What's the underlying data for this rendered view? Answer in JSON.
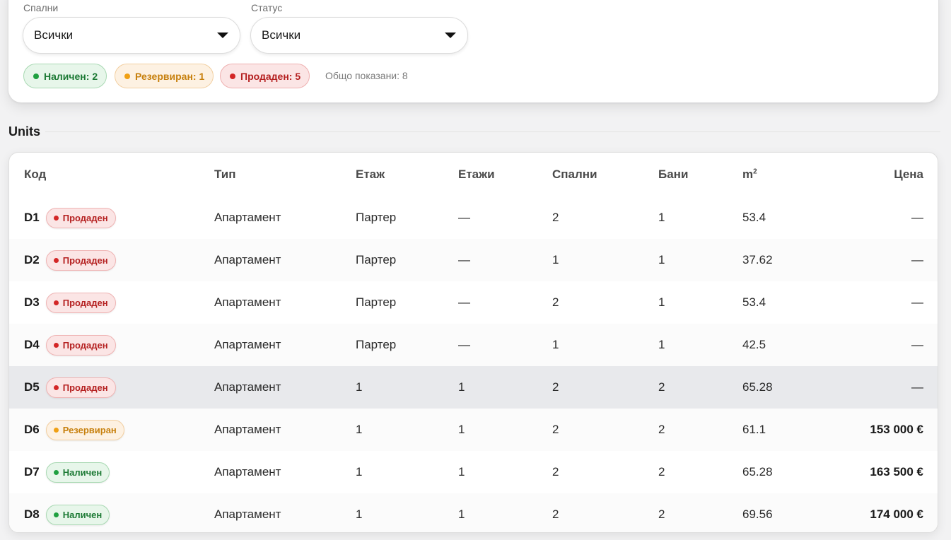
{
  "filters": {
    "bedrooms": {
      "label": "Спални",
      "value": "Всички"
    },
    "status": {
      "label": "Статус",
      "value": "Всички"
    },
    "pills": [
      {
        "label": "Наличен: 2",
        "color": "#1fa040"
      },
      {
        "label": "Резервиран: 1",
        "color": "#f0a014"
      },
      {
        "label": "Продаден: 5",
        "color": "#d32626"
      }
    ],
    "total_shown": "Общо показани: 8"
  },
  "units": {
    "title": "Units",
    "columns": {
      "code": "Код",
      "type": "Тип",
      "floor": "Етаж",
      "floors": "Етажи",
      "bedrooms": "Спални",
      "bathrooms": "Бани",
      "area": "m",
      "area_sup": "2",
      "price": "Цена"
    },
    "rows": [
      {
        "code": "D1",
        "status": "Продаден",
        "type": "Апартамент",
        "floor": "Партер",
        "floors": "—",
        "bedrooms": "2",
        "bathrooms": "1",
        "area": "53.4",
        "price": "—"
      },
      {
        "code": "D2",
        "status": "Продаден",
        "type": "Апартамент",
        "floor": "Партер",
        "floors": "—",
        "bedrooms": "1",
        "bathrooms": "1",
        "area": "37.62",
        "price": "—"
      },
      {
        "code": "D3",
        "status": "Продаден",
        "type": "Апартамент",
        "floor": "Партер",
        "floors": "—",
        "bedrooms": "2",
        "bathrooms": "1",
        "area": "53.4",
        "price": "—"
      },
      {
        "code": "D4",
        "status": "Продаден",
        "type": "Апартамент",
        "floor": "Партер",
        "floors": "—",
        "bedrooms": "1",
        "bathrooms": "1",
        "area": "42.5",
        "price": "—"
      },
      {
        "code": "D5",
        "status": "Продаден",
        "type": "Апартамент",
        "floor": "1",
        "floors": "1",
        "bedrooms": "2",
        "bathrooms": "2",
        "area": "65.28",
        "price": "—"
      },
      {
        "code": "D6",
        "status": "Резервиран",
        "type": "Апартамент",
        "floor": "1",
        "floors": "1",
        "bedrooms": "2",
        "bathrooms": "2",
        "area": "61.1",
        "price": "153 000 €"
      },
      {
        "code": "D7",
        "status": "Наличен",
        "type": "Апартамент",
        "floor": "1",
        "floors": "1",
        "bedrooms": "2",
        "bathrooms": "2",
        "area": "65.28",
        "price": "163 500 €"
      },
      {
        "code": "D8",
        "status": "Наличен",
        "type": "Апартамент",
        "floor": "1",
        "floors": "1",
        "bedrooms": "2",
        "bathrooms": "2",
        "area": "69.56",
        "price": "174 000 €"
      }
    ]
  }
}
